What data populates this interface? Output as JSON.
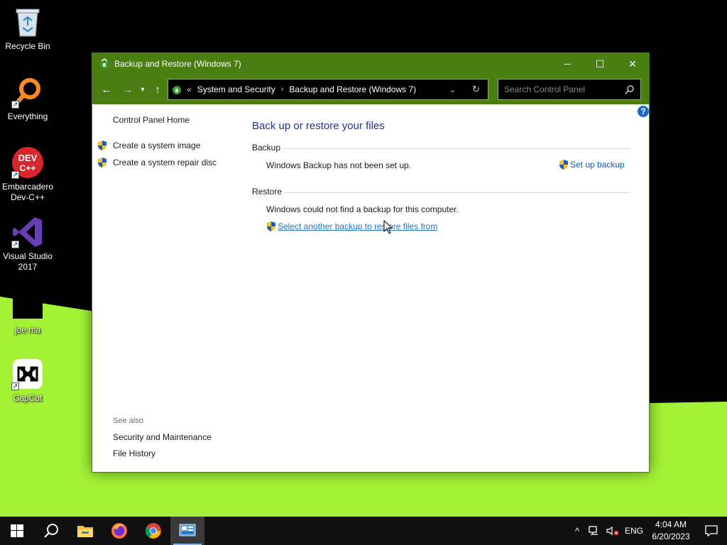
{
  "desktop": {
    "icons": [
      {
        "label": "Recycle Bin",
        "icon": "recycle-bin-icon"
      },
      {
        "label": "Everything",
        "icon": "everything-search-icon"
      },
      {
        "label": "Embarcadero\nDev-C++",
        "icon": "dev-cpp-icon",
        "badge": "DEV\nC++"
      },
      {
        "label": "Visual Studio\n2017",
        "icon": "visual-studio-icon"
      },
      {
        "label": "joe ma",
        "icon": "user-folder-icon"
      },
      {
        "label": "CapCut",
        "icon": "capcut-icon"
      }
    ]
  },
  "window": {
    "title": "Backup and Restore (Windows 7)",
    "controls": {
      "minimize": "─",
      "maximize": "☐",
      "close": "✕"
    },
    "address": {
      "overflow": "«",
      "crumbs": [
        "System and Security",
        "Backup and Restore (Windows 7)"
      ],
      "separator": "›"
    },
    "search": {
      "placeholder": "Search Control Panel"
    },
    "left_pane": {
      "home": "Control Panel Home",
      "links": [
        "Create a system image",
        "Create a system repair disc"
      ],
      "see_also_heading": "See also",
      "see_also": [
        "Security and Maintenance",
        "File History"
      ]
    },
    "main": {
      "title": "Back up or restore your files",
      "backup": {
        "heading": "Backup",
        "message": "Windows Backup has not been set up.",
        "action": "Set up backup"
      },
      "restore": {
        "heading": "Restore",
        "message": "Windows could not find a backup for this computer.",
        "action": "Select another backup to restore files from"
      },
      "help": "?"
    }
  },
  "taskbar": {
    "apps": [
      "start-icon",
      "search-icon",
      "file-explorer-icon",
      "firefox-icon",
      "chrome-icon",
      "control-panel-icon"
    ],
    "tray": {
      "chevron": "^",
      "language": "ENG",
      "time": "4:04 AM",
      "date": "6/20/2023"
    }
  },
  "colors": {
    "title_bar": "#4a7d12",
    "wallpaper_green": "#a4f235",
    "link_blue": "#0a5fb4",
    "heading_blue": "#1e3287"
  }
}
